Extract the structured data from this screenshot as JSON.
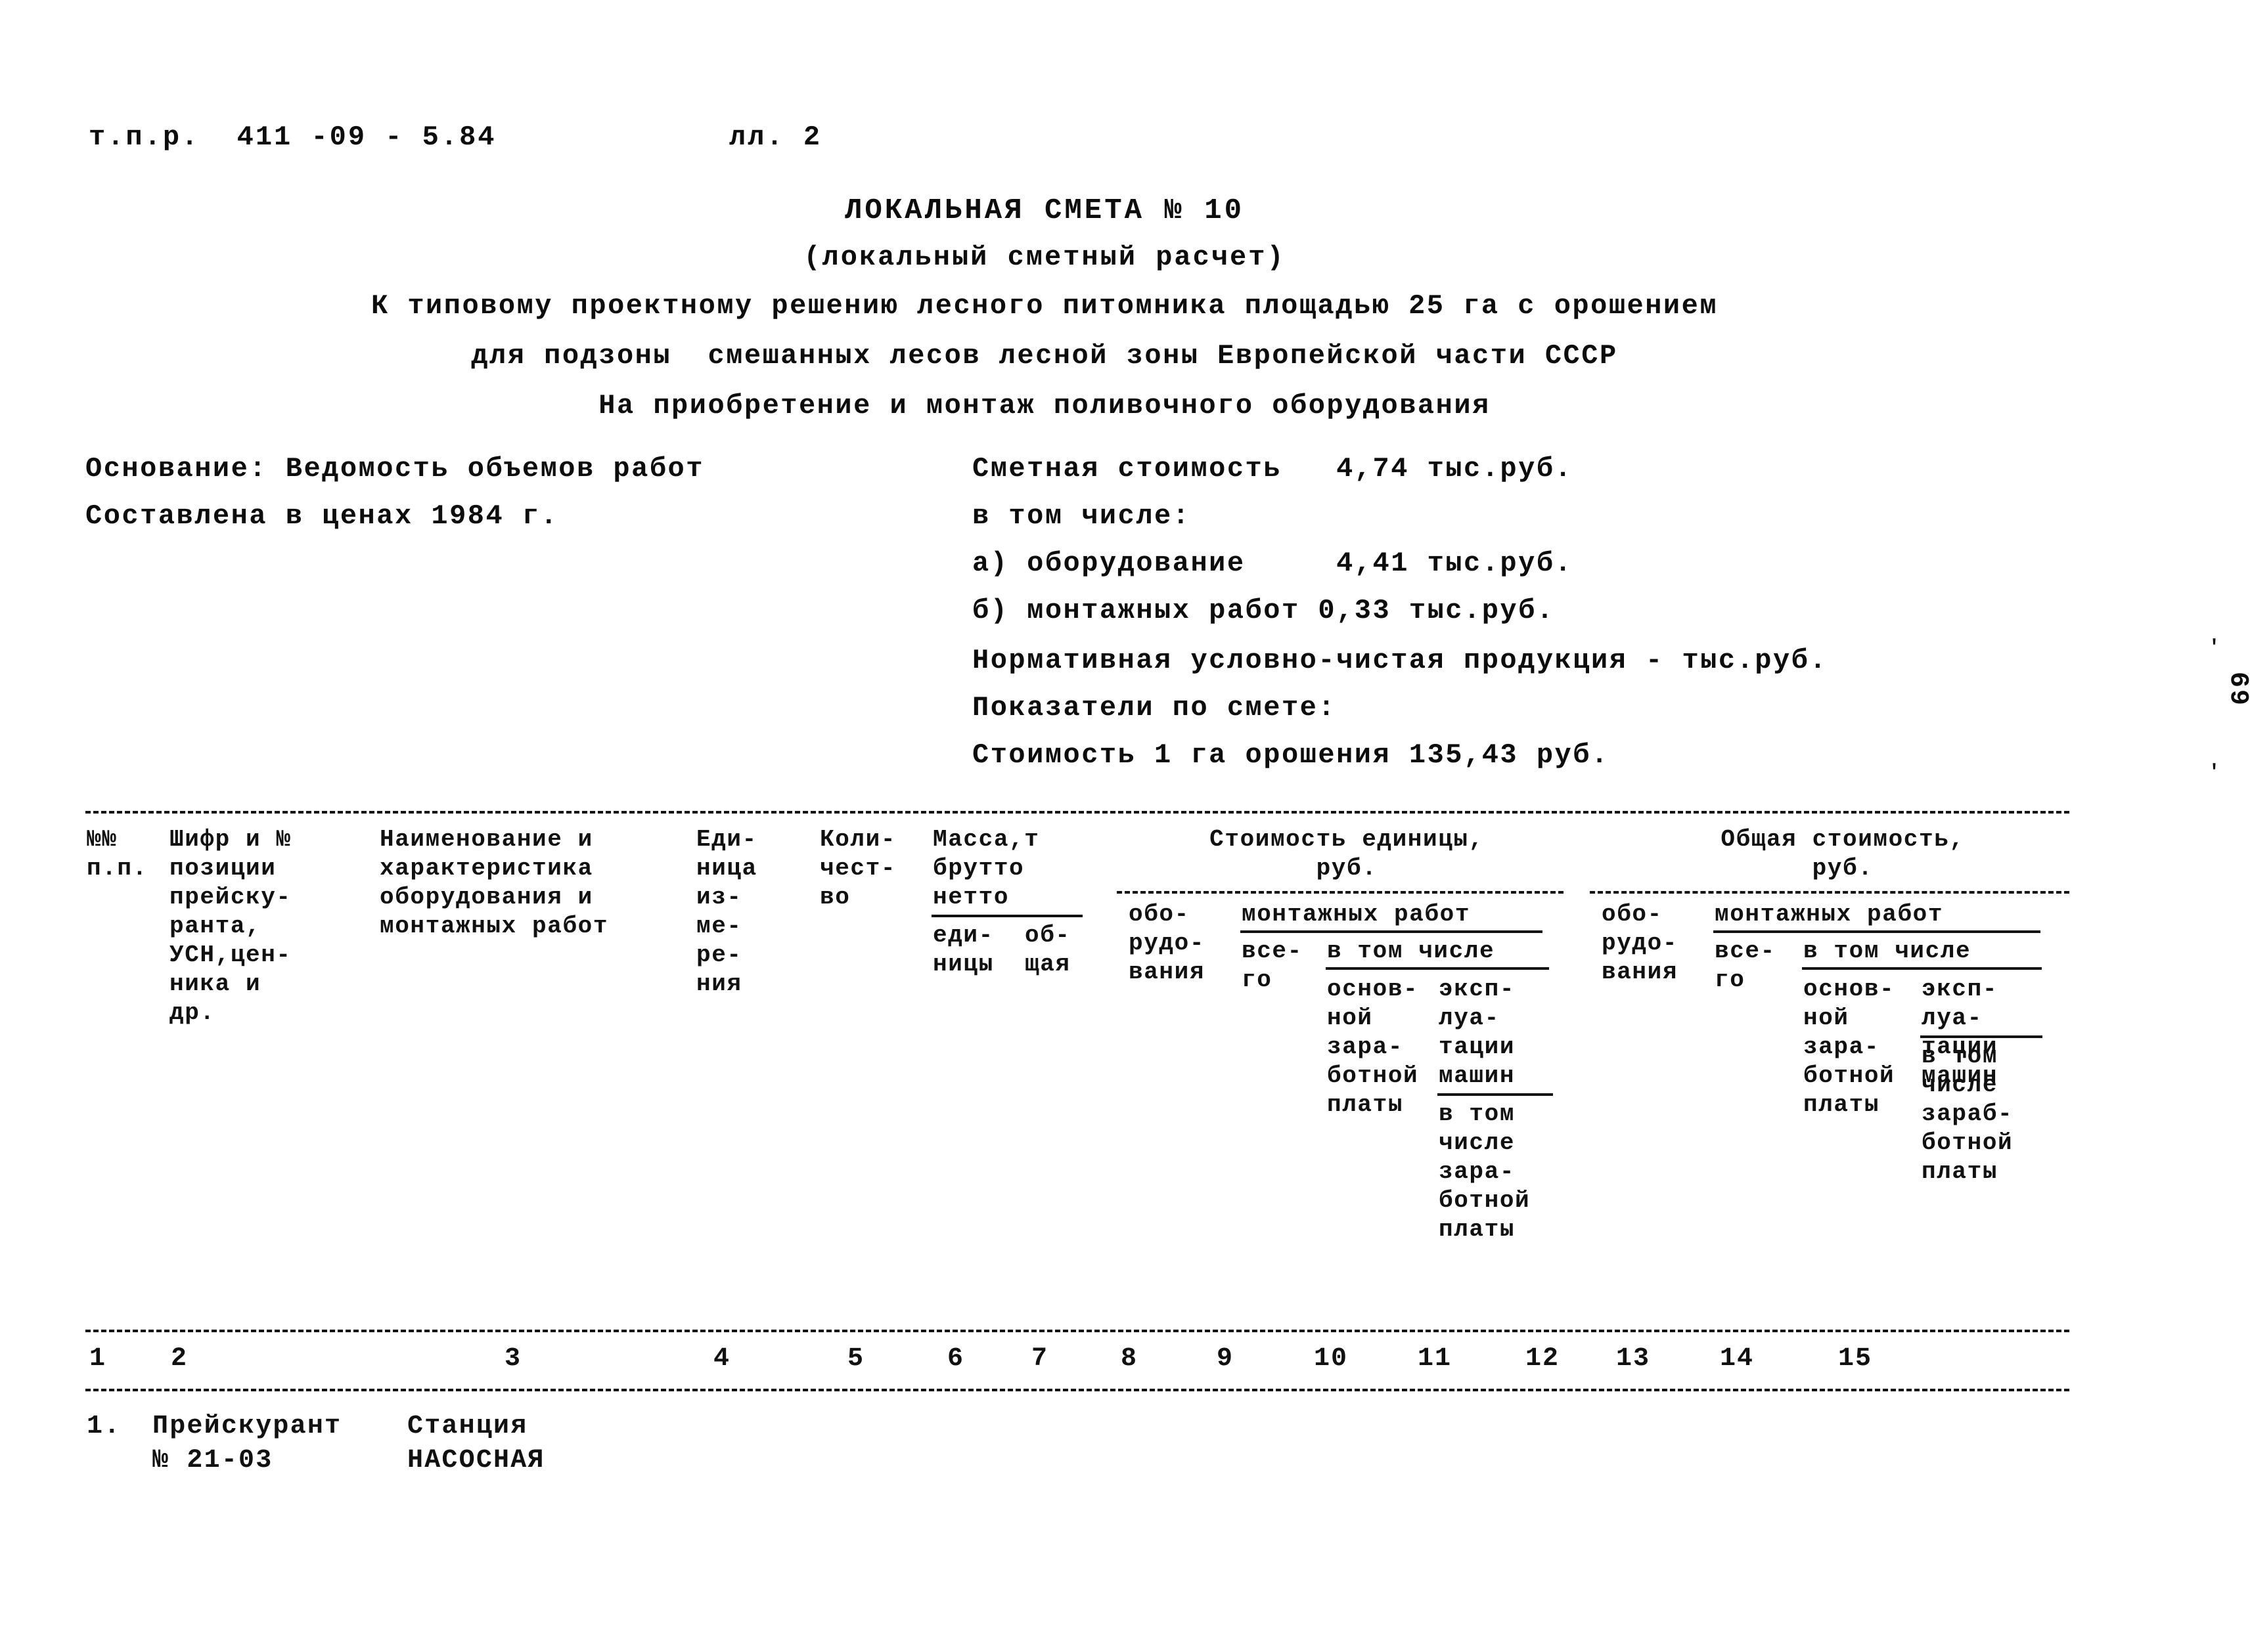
{
  "header": {
    "doc_code": "т.п.р.  411 -09 - 5.84",
    "sheet_no": "лл. 2"
  },
  "titles": {
    "main": "ЛОКАЛЬНАЯ СМЕТА № 10",
    "sub": "(локальный сметный расчет)",
    "desc_1": "К типовому проектному решению лесного питомника площадью 25 га с орошением",
    "desc_2": "для подзоны  смешанных лесов лесной зоны Европейской части СССР",
    "desc_3": "На приобретение и монтаж поливочного оборудования"
  },
  "left_info": {
    "basis": "Основание: Ведомость объемов работ",
    "prices": "Составлена в ценах 1984 г."
  },
  "right_info": {
    "cost_total": "Сметная стоимость   4,74 тыс.руб.",
    "included_label": "в том числе:",
    "included_a": "а) оборудование     4,41 тыс.руб.",
    "included_b": "б) монтажных работ 0,33 тыс.руб.",
    "nchp": "Нормативная условно-чистая продукция - тыс.руб.",
    "indicators_label": "Показатели по смете:",
    "indicator_1": "Стоимость 1 га орошения 135,43 руб."
  },
  "page_number": "69",
  "table": {
    "headers": {
      "c1": "№№\nп.п.",
      "c2": "Шифр и №\nпозиции\nпрейску-\nранта,\nУСН,цен-\nника и\nдр.",
      "c3": "Наименование и\nхарактеристика\nоборудования и\nмонтажных работ",
      "c4": "Еди-\nница\nиз-\nме-\nре-\nния",
      "c5": "Коли-\nчест-\nво",
      "c6_title": "Масса,т\nбрутто",
      "c6_net": "нетто",
      "c6_a": "еди-\nницы",
      "c6_b": "об-\nщая",
      "unit_cost_title": "Стоимость единицы,",
      "unit_cost_units": "руб.",
      "unit_equip": "обо-\nрудо-\nвания",
      "unit_mont_title": "монтажных работ",
      "unit_mont_total": "все-\nго",
      "unit_mont_incl": "в том числе",
      "unit_mont_basic": "основ-\nной\nзара-\nботной\nплаты",
      "unit_mont_mach": "эксп-\nлуа-\nтации\nмашин",
      "unit_mont_mach_incl": "в том\nчисле\nзара-\nботной\nплаты",
      "total_cost_title": "Общая стоимость,",
      "total_cost_units": "руб.",
      "total_equip": "обо-\nрудо-\nвания",
      "total_mont_title": "монтажных работ",
      "total_mont_total": "все-\nго",
      "total_mont_incl": "в том числе",
      "total_mont_basic": "основ-\nной\nзара-\nботной\nплаты",
      "total_mont_mach": "эксп-\nлуа-\nтации\nмашин",
      "total_mont_mach_incl": "в том\nчисле\nзараб-\nботной\nплаты"
    },
    "column_numbers": [
      "1",
      "2",
      "3",
      "4",
      "5",
      "6",
      "7",
      "8",
      "9",
      "10",
      "11",
      "12",
      "13",
      "14",
      "15"
    ],
    "rows": [
      {
        "num": "1.",
        "code": "Прейскурант\n№ 21-03",
        "name": "Станция\nНАСОСНАЯ",
        "unit": "",
        "qty": "",
        "mass_unit": "",
        "mass_total": "",
        "u_equip": "",
        "u_mont_all": "",
        "u_mont_basic": "",
        "u_mont_mach": "",
        "t_equip": "",
        "t_mont_all": "",
        "t_mont_basic": "",
        "t_mont_mach": "",
        "t_mont_mach_incl": ""
      }
    ]
  }
}
